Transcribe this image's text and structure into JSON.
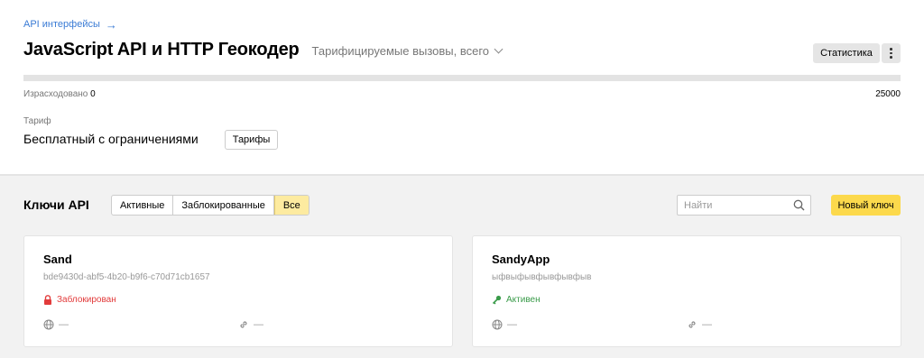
{
  "breadcrumb": {
    "label": "API интерфейсы",
    "arrow": "→"
  },
  "header": {
    "title": "JavaScript API и HTTP Геокодер",
    "calls_select": "Тарифицируемые вызовы, всего",
    "stats_button": "Статистика"
  },
  "usage": {
    "used_label": "Израсходовано",
    "used_value": "0",
    "limit": "25000",
    "fraction": 0
  },
  "tariff": {
    "label": "Тариф",
    "value": "Бесплатный с ограничениями",
    "button": "Тарифы"
  },
  "keys": {
    "title": "Ключи API",
    "filters": [
      "Активные",
      "Заблокированные",
      "Все"
    ],
    "selected_filter": "Все",
    "search_placeholder": "Найти",
    "new_key_button": "Новый ключ",
    "cards": [
      {
        "name": "Sand",
        "key": "bde9430d-abf5-4b20-b9f6-c70d71cb1657",
        "status": "Заблокирован",
        "status_icon": "lock-icon",
        "status_color": "#e23b3b",
        "site": "—",
        "link": "—"
      },
      {
        "name": "SandyApp",
        "key": "ыфвыфывфывфывфыв",
        "status": "Активен",
        "status_icon": "key-icon",
        "status_color": "#3a9b4a",
        "site": "—",
        "link": "—"
      }
    ]
  },
  "colors": {
    "accent_yellow": "#fcd94c",
    "link_blue": "#3a7bd5"
  }
}
